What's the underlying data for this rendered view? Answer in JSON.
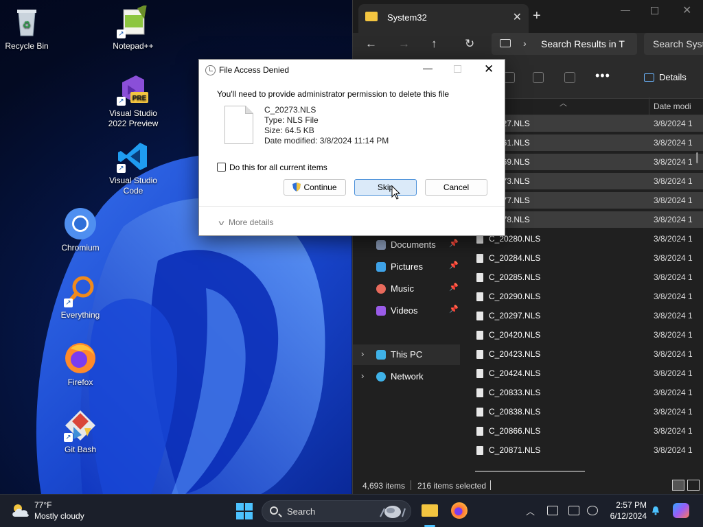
{
  "desktop": {
    "icons": [
      {
        "label": "Recycle Bin",
        "icon": "recycle-bin-icon"
      },
      {
        "label": "Notepad++",
        "icon": "notepadpp-icon"
      },
      {
        "label": "Visual Studio\n2022 Preview",
        "line1": "Visual Studio",
        "line2": "2022 Preview",
        "badge": "PRE",
        "icon": "visual-studio-preview-icon"
      },
      {
        "line1": "Visual Studio",
        "line2": "Code",
        "icon": "vscode-icon"
      },
      {
        "label": "Chromium",
        "icon": "chromium-icon"
      },
      {
        "label": "Everything",
        "icon": "everything-search-icon"
      },
      {
        "label": "Firefox",
        "icon": "firefox-icon"
      },
      {
        "label": "Git Bash",
        "icon": "git-bash-icon"
      }
    ]
  },
  "explorer": {
    "tab_title": "System32",
    "address_text": "Search Results in T",
    "search_placeholder": "Search Syste",
    "more_label": "•••",
    "details_label": "Details",
    "date_column": "Date modi",
    "sidebar": [
      {
        "label": "Documents",
        "icon": "documents-icon",
        "color": "#8a9bb8"
      },
      {
        "label": "Pictures",
        "icon": "pictures-icon",
        "color": "#3fa3e8"
      },
      {
        "label": "Music",
        "icon": "music-icon",
        "color": "#e86a5c"
      },
      {
        "label": "Videos",
        "icon": "videos-icon",
        "color": "#9a5ce8"
      },
      {
        "label": "This PC",
        "icon": "this-pc-icon",
        "color": "#3fb2e8"
      },
      {
        "label": "Network",
        "icon": "network-icon",
        "color": "#3fb2e8"
      }
    ],
    "files": [
      {
        "name": "127.NLS",
        "date": "3/8/2024 1"
      },
      {
        "name": "261.NLS",
        "date": "3/8/2024 1"
      },
      {
        "name": "269.NLS",
        "date": "3/8/2024 1"
      },
      {
        "name": "273.NLS",
        "date": "3/8/2024 1"
      },
      {
        "name": "277.NLS",
        "date": "3/8/2024 1"
      },
      {
        "name": "278.NLS",
        "date": "3/8/2024 1"
      },
      {
        "name": "C_20280.NLS",
        "date": "3/8/2024 1"
      },
      {
        "name": "C_20284.NLS",
        "date": "3/8/2024 1"
      },
      {
        "name": "C_20285.NLS",
        "date": "3/8/2024 1"
      },
      {
        "name": "C_20290.NLS",
        "date": "3/8/2024 1"
      },
      {
        "name": "C_20297.NLS",
        "date": "3/8/2024 1"
      },
      {
        "name": "C_20420.NLS",
        "date": "3/8/2024 1"
      },
      {
        "name": "C_20423.NLS",
        "date": "3/8/2024 1"
      },
      {
        "name": "C_20424.NLS",
        "date": "3/8/2024 1"
      },
      {
        "name": "C_20833.NLS",
        "date": "3/8/2024 1"
      },
      {
        "name": "C_20838.NLS",
        "date": "3/8/2024 1"
      },
      {
        "name": "C_20866.NLS",
        "date": "3/8/2024 1"
      },
      {
        "name": "C_20871.NLS",
        "date": "3/8/2024 1"
      }
    ],
    "status_count": "4,693 items",
    "status_selected": "216 items selected"
  },
  "dialog": {
    "title": "File Access Denied",
    "message": "You'll need to provide administrator permission to delete this file",
    "file_name": "C_20273.NLS",
    "file_type": "Type: NLS File",
    "file_size": "Size: 64.5 KB",
    "file_date": "Date modified: 3/8/2024 11:14 PM",
    "checkbox_label": "Do this for all current items",
    "checkbox_checked": false,
    "continue_label": "Continue",
    "skip_label": "Skip",
    "cancel_label": "Cancel",
    "more_details": "More details"
  },
  "taskbar": {
    "weather_temp": "77°F",
    "weather_cond": "Mostly cloudy",
    "search_label": "Search",
    "time": "2:57 PM",
    "date": "6/12/2024",
    "accent": "#4cc2ff"
  }
}
